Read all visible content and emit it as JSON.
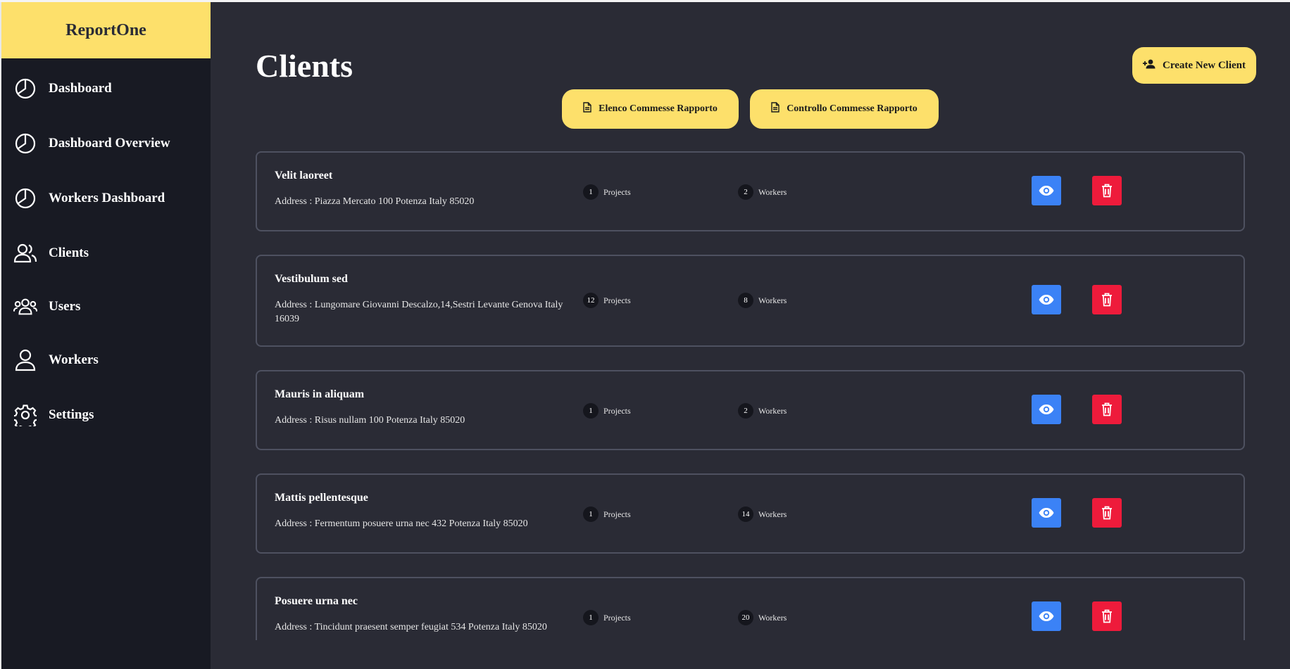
{
  "app": {
    "brand": "ReportOne"
  },
  "sidebar": {
    "items": [
      {
        "label": "Dashboard",
        "icon": "pie-chart-icon"
      },
      {
        "label": "Dashboard Overview",
        "icon": "pie-chart-icon"
      },
      {
        "label": "Workers Dashboard",
        "icon": "pie-chart-icon"
      },
      {
        "label": "Clients",
        "icon": "users-icon"
      },
      {
        "label": "Users",
        "icon": "user-group-icon"
      },
      {
        "label": "Workers",
        "icon": "user-icon"
      },
      {
        "label": "Settings",
        "icon": "gear-icon"
      }
    ]
  },
  "header": {
    "title": "Clients",
    "create_button": "Create New Client",
    "elenco_button": "Elenco Commesse Rapporto",
    "controllo_button": "Controllo Commesse Rapporto"
  },
  "clients": [
    {
      "name": "Velit laoreet",
      "address": "Address : Piazza Mercato 100 Potenza Italy 85020",
      "projects": "1",
      "workers": "2"
    },
    {
      "name": "Vestibulum sed",
      "address": "Address : Lungomare Giovanni Descalzo,14,Sestri Levante Genova Italy 16039",
      "projects": "12",
      "workers": "8"
    },
    {
      "name": "Mauris in aliquam",
      "address": "Address : Risus nullam 100 Potenza Italy 85020",
      "projects": "1",
      "workers": "2"
    },
    {
      "name": "Mattis pellentesque",
      "address": "Address : Fermentum posuere urna nec 432 Potenza Italy 85020",
      "projects": "1",
      "workers": "14"
    },
    {
      "name": "Posuere urna nec",
      "address": "Address : Tincidunt praesent semper feugiat 534 Potenza Italy 85020",
      "projects": "1",
      "workers": "20"
    }
  ],
  "labels": {
    "projects": "Projects",
    "workers": "Workers"
  },
  "colors": {
    "accent": "#fde06b",
    "view": "#3b82f6",
    "delete": "#ee1b3b",
    "background": "#2a2b35",
    "sidebar": "#181a23"
  }
}
